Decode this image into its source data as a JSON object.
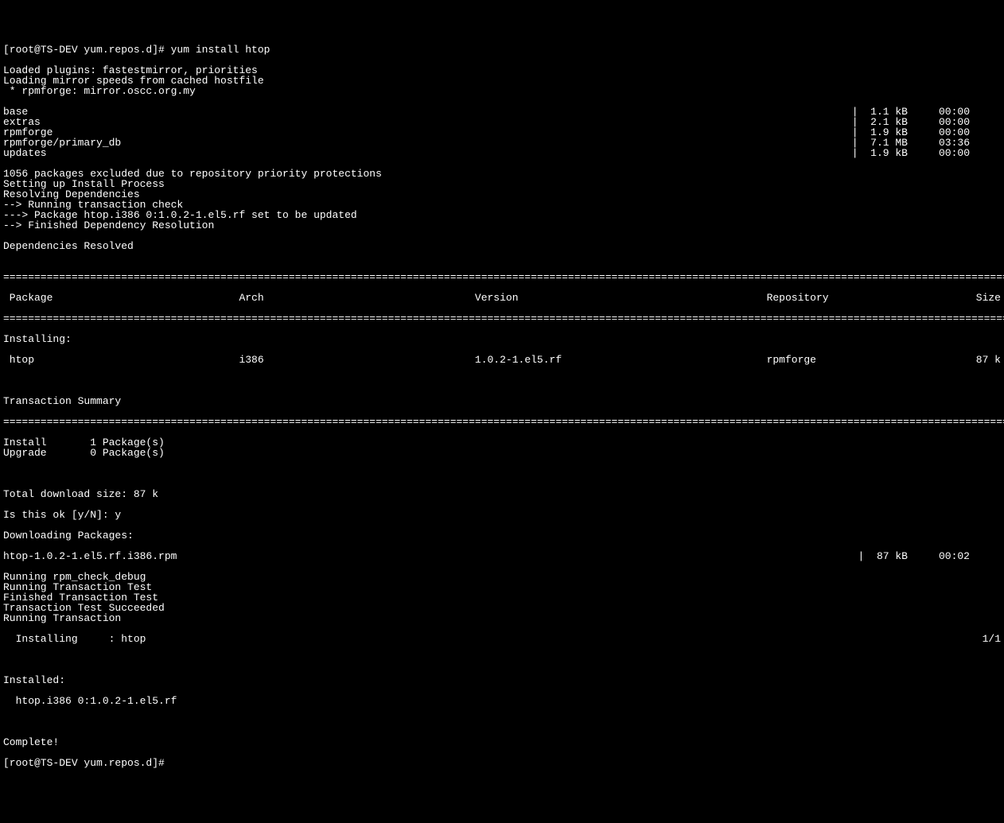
{
  "prompt1": "[root@TS-DEV yum.repos.d]# yum install htop",
  "preamble": [
    "Loaded plugins: fastestmirror, priorities",
    "Loading mirror speeds from cached hostfile",
    " * rpmforge: mirror.oscc.org.my"
  ],
  "repos": [
    {
      "name": "base",
      "size": "1.1 kB",
      "time": "00:00"
    },
    {
      "name": "extras",
      "size": "2.1 kB",
      "time": "00:00"
    },
    {
      "name": "rpmforge",
      "size": "1.9 kB",
      "time": "00:00"
    },
    {
      "name": "rpmforge/primary_db",
      "size": "7.1 MB",
      "time": "03:36"
    },
    {
      "name": "updates",
      "size": "1.9 kB",
      "time": "00:00"
    }
  ],
  "mid": [
    "1056 packages excluded due to repository priority protections",
    "Setting up Install Process",
    "Resolving Dependencies",
    "--> Running transaction check",
    "---> Package htop.i386 0:1.0.2-1.el5.rf set to be updated",
    "--> Finished Dependency Resolution",
    "",
    "Dependencies Resolved",
    ""
  ],
  "hdr": {
    "pkg": " Package",
    "arch": "Arch",
    "ver": "Version",
    "repo": "Repository",
    "size": "Size"
  },
  "installingLabel": "Installing:",
  "row": {
    "pkg": " htop",
    "arch": "i386",
    "ver": "1.0.2-1.el5.rf",
    "repo": "rpmforge",
    "size": "87 k"
  },
  "txsum": "Transaction Summary",
  "counts": [
    "Install       1 Package(s)",
    "Upgrade       0 Package(s)"
  ],
  "dl": {
    "total": "Total download size: 87 k",
    "ask": "Is this ok [y/N]: y",
    "start": "Downloading Packages:",
    "file": "htop-1.0.2-1.el5.rf.i386.rpm",
    "filesize": " 87 kB",
    "filetime": "00:02"
  },
  "post": [
    "Running rpm_check_debug",
    "Running Transaction Test",
    "Finished Transaction Test",
    "Transaction Test Succeeded",
    "Running Transaction"
  ],
  "installing": {
    "left": "  Installing     : htop",
    "right": "1/1"
  },
  "installed": {
    "hdr": "Installed:",
    "item": "  htop.i386 0:1.0.2-1.el5.rf"
  },
  "complete": "Complete!",
  "prompt2": "[root@TS-DEV yum.repos.d]# "
}
